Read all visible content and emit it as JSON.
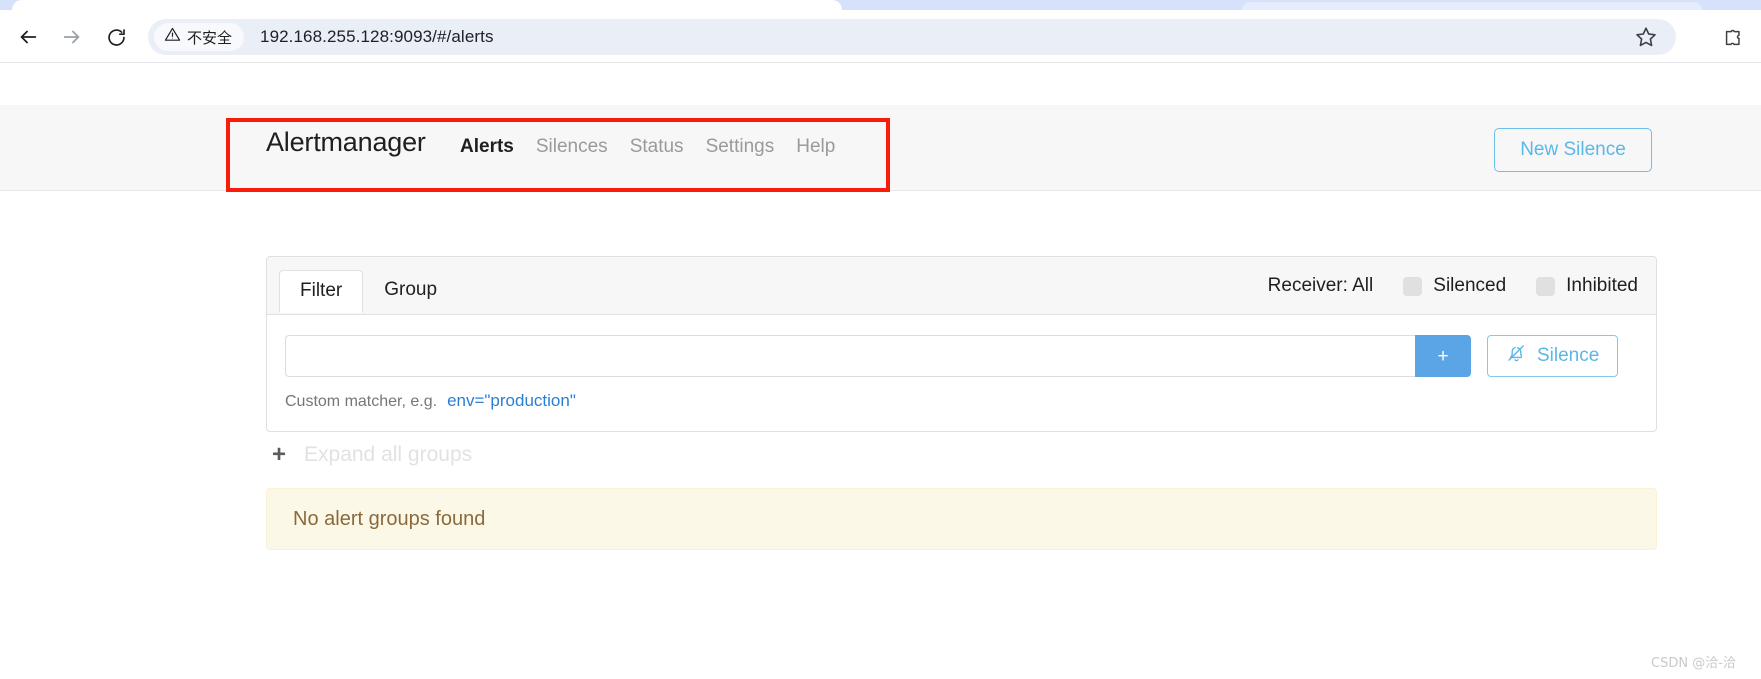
{
  "browser": {
    "back_icon": "arrow-left-icon",
    "forward_icon": "arrow-right-icon",
    "reload_icon": "reload-icon",
    "security_chip_text": "不安全",
    "security_icon": "warning-triangle-icon",
    "url": "192.168.255.128:9093/#/alerts",
    "bookmark_icon": "star-icon",
    "extensions_icon": "puzzle-piece-icon"
  },
  "navbar": {
    "brand": "Alertmanager",
    "links": [
      {
        "label": "Alerts",
        "active": true
      },
      {
        "label": "Silences",
        "active": false
      },
      {
        "label": "Status",
        "active": false
      },
      {
        "label": "Settings",
        "active": false
      },
      {
        "label": "Help",
        "active": false
      }
    ],
    "new_silence_label": "New Silence",
    "annotation_color": "#f81c0b"
  },
  "filter_card": {
    "tabs": [
      {
        "label": "Filter",
        "active": true
      },
      {
        "label": "Group",
        "active": false
      }
    ],
    "receiver_label": "Receiver: All",
    "toggles": [
      {
        "label": "Silenced",
        "checked": false
      },
      {
        "label": "Inhibited",
        "checked": false
      }
    ],
    "matcher_input_value": "",
    "matcher_input_placeholder": "",
    "add_button_label": "+",
    "silence_button_label": "Silence",
    "silence_button_icon": "bell-slash-icon",
    "help_text": "Custom matcher, e.g.",
    "help_example": "env=\"production\""
  },
  "groups": {
    "expand_icon": "plus-icon",
    "expand_label": "Expand all groups",
    "empty_message": "No alert groups found"
  },
  "watermark": "CSDN @洽-洽",
  "colors": {
    "accent_blue": "#5ba4e6",
    "link_blue": "#2a7fd4",
    "warning_bg": "#fcf8e8",
    "warning_text": "#8a6a3c"
  }
}
